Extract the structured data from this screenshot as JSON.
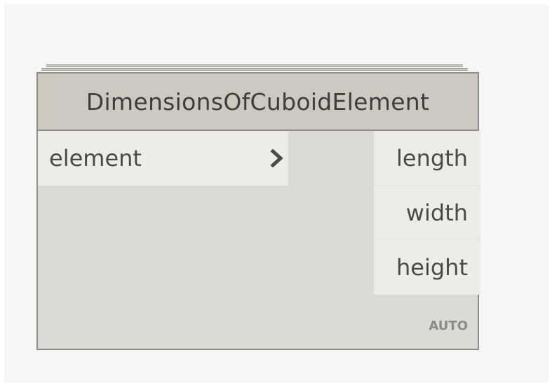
{
  "node": {
    "title": "DimensionsOfCuboidElement",
    "inputs": [
      {
        "label": "element"
      }
    ],
    "outputs": [
      {
        "label": "length"
      },
      {
        "label": "width"
      },
      {
        "label": "height"
      }
    ],
    "lacing": "AUTO"
  },
  "colors": {
    "header": "#cdc8c0",
    "body": "#dcdad5",
    "port": "#eeece8",
    "border": "#8e8c88",
    "text": "#3d3d3d"
  },
  "icons": {
    "input_port_arrow": "chevron-right-icon"
  }
}
